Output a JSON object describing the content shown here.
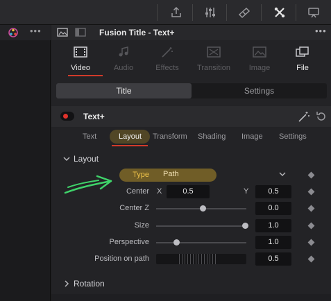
{
  "inspector": {
    "title": "Fusion Title - Text+",
    "category_tabs": [
      {
        "label": "Video",
        "icon": "film-icon"
      },
      {
        "label": "Audio",
        "icon": "music-note-icon"
      },
      {
        "label": "Effects",
        "icon": "magic-wand-icon"
      },
      {
        "label": "Transition",
        "icon": "transition-icon"
      },
      {
        "label": "Image",
        "icon": "image-icon"
      },
      {
        "label": "File",
        "icon": "file-icon"
      }
    ],
    "segments": [
      "Title",
      "Settings"
    ],
    "node_title": "Text+",
    "sub_tabs": [
      "Text",
      "Layout",
      "Transform",
      "Shading",
      "Image",
      "Settings"
    ],
    "section_layout": "Layout",
    "type_label": "Type",
    "type_value": "Path",
    "center_label": "Center",
    "center_x_label": "X",
    "center_x_value": "0.5",
    "center_y_label": "Y",
    "center_y_value": "0.5",
    "centerz_label": "Center Z",
    "centerz_value": "0.0",
    "size_label": "Size",
    "size_value": "1.0",
    "perspective_label": "Perspective",
    "perspective_value": "1.0",
    "position_on_path_label": "Position on path",
    "position_on_path_value": "0.5",
    "section_rotation": "Rotation"
  },
  "colors": {
    "accent_red": "#d13a2a",
    "highlight_yellow": "#b08e28",
    "annotation_green": "#3fd36a"
  }
}
